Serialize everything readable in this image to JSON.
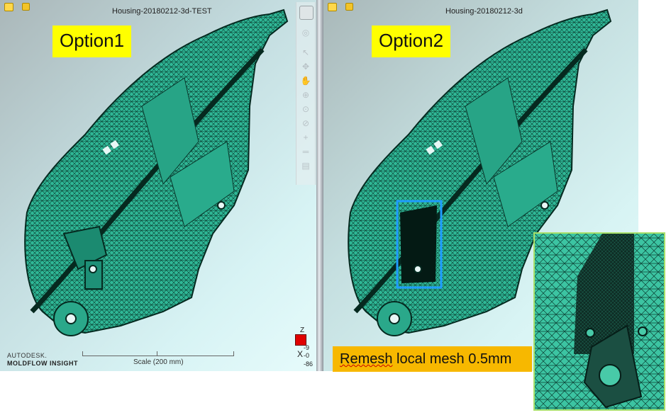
{
  "left_view": {
    "title": "Housing-20180212-3d-TEST",
    "option_label": "Option1",
    "logo_line1": "AUTODESK.",
    "logo_line2": "MOLDFLOW INSIGHT",
    "scale_label": "Scale (200 mm)",
    "axis": {
      "z": "Z",
      "x": "X",
      "values": [
        "-9",
        "-0",
        "-86"
      ]
    }
  },
  "right_view": {
    "title": "Housing-20180212-3d",
    "option_label": "Option2"
  },
  "annotation": {
    "remesh_first_word": "Remesh",
    "remesh_rest": " local mesh 0.5mm"
  },
  "toolbar_icons": [
    "view-cube-icon",
    "orbit-ring-icon",
    "select-arrow-icon",
    "pan-move-icon",
    "hand-icon",
    "zoom-plus-icon",
    "zoom-window-icon",
    "zoom-icon",
    "center-icon",
    "measure-icon",
    "clipboard-icon"
  ],
  "colors": {
    "mesh": "#2fb897",
    "highlight_box": "#1f9cff",
    "label_bg": "#ffff00",
    "remesh_bg": "#f7b800"
  }
}
